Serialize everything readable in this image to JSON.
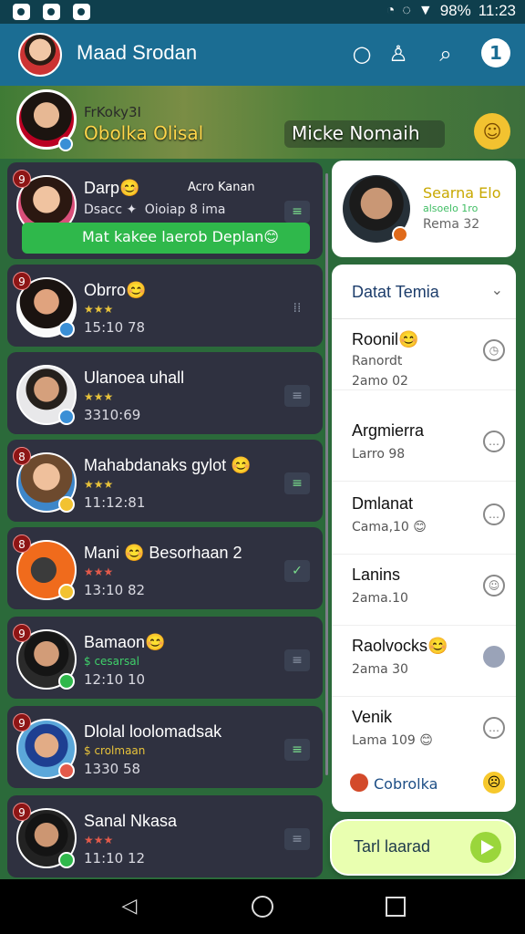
{
  "status_bar": {
    "battery": "98%",
    "time": "11:23"
  },
  "header": {
    "title": "Maad Srodan"
  },
  "story_bar": {
    "left_small": "FrKoky3I",
    "left_name": "Obolka Olisal",
    "right_name": "Micke Nomaih"
  },
  "chats": [
    {
      "badge": "9",
      "name": "Darp😊",
      "tag": "Acro Kanan",
      "sub": "Oioiap 8 ima",
      "sub2": "Dsacc ✦",
      "banner": "Mat kakee laerob Deplan😊"
    },
    {
      "badge": "9",
      "name": "Obrro😊",
      "sub": "★★★",
      "time": "15:10 78"
    },
    {
      "badge": "",
      "name": "Ulanoea uhall",
      "sub": "★★★",
      "time": "3310:69"
    },
    {
      "badge": "8",
      "name": "Mahabdanaks gylot 😊",
      "sub": "★★★",
      "time": "11:12:81"
    },
    {
      "badge": "8",
      "name": "Mani 😊 Besorhaan 2",
      "sub": "★★★",
      "time": "13:10 82"
    },
    {
      "badge": "9",
      "name": "Bamaon😊",
      "sub": "$ cesarsal",
      "time": "12:10 10"
    },
    {
      "badge": "9",
      "name": "Dlolal loolomadsak",
      "sub": "$ crolmaan",
      "time": "1330 58"
    },
    {
      "badge": "9",
      "name": "Sanal Nkasa",
      "sub": "★★★",
      "time": "11:10 12"
    }
  ],
  "profile": {
    "name": "Searna Elo",
    "sub": "alsoelo 1ro",
    "num": "Rema 32"
  },
  "side_panel": {
    "header": "Datat Temia",
    "items": [
      {
        "title": "Roonil😊",
        "sub": "Ranordt",
        "sub2": "2amo 02"
      },
      {
        "title": "Argmierra",
        "sub": "Larro 98"
      },
      {
        "title": "Dmlanat",
        "sub": "Cama,10 😊"
      },
      {
        "title": "Lanins",
        "sub": "2ama.10"
      },
      {
        "title": "Raolvocks😊",
        "sub": "2ama 30"
      },
      {
        "title": "Venik",
        "sub": "Lama 109 😊"
      }
    ],
    "footer": "Cobrolka"
  },
  "cta": {
    "label": "Tarl laarad"
  }
}
